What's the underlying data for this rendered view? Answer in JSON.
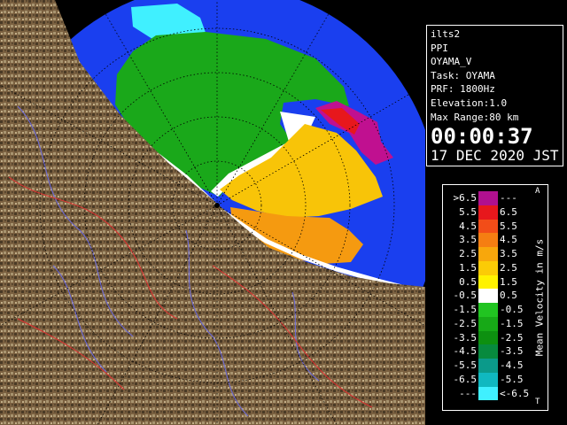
{
  "info": {
    "station_code": "ilts2",
    "product": "PPI",
    "radar_name": "OYAMA_V",
    "task": "Task: OYAMA",
    "prf": "PRF: 1800Hz",
    "elevation": "Elevation:1.0",
    "max_range": "Max Range:80 km",
    "time": "00:00:37",
    "date": "17 DEC 2020 JST"
  },
  "legend": {
    "title": "Mean Velocity in m/s",
    "corner_top": "A",
    "corner_bottom": "T",
    "rows": [
      {
        "lo": ">6.5",
        "hi": "---",
        "color": "#b0108f"
      },
      {
        "lo": "5.5",
        "hi": "6.5",
        "color": "#e7171c"
      },
      {
        "lo": "4.5",
        "hi": "5.5",
        "color": "#f24d18"
      },
      {
        "lo": "3.5",
        "hi": "4.5",
        "color": "#f57e12"
      },
      {
        "lo": "2.5",
        "hi": "3.5",
        "color": "#f8a70c"
      },
      {
        "lo": "1.5",
        "hi": "2.5",
        "color": "#fbcb06"
      },
      {
        "lo": "0.5",
        "hi": "1.5",
        "color": "#fff200"
      },
      {
        "lo": "-0.5",
        "hi": "0.5",
        "color": "#ffffff"
      },
      {
        "lo": "-1.5",
        "hi": "-0.5",
        "color": "#21c421"
      },
      {
        "lo": "-2.5",
        "hi": "-1.5",
        "color": "#17a917"
      },
      {
        "lo": "-3.5",
        "hi": "-2.5",
        "color": "#0d9010"
      },
      {
        "lo": "-4.5",
        "hi": "-3.5",
        "color": "#078a3e"
      },
      {
        "lo": "-5.5",
        "hi": "-4.5",
        "color": "#0b9a8a"
      },
      {
        "lo": "-6.5",
        "hi": "-5.5",
        "color": "#10b8c0"
      },
      {
        "lo": "---",
        "hi": "<-6.5",
        "color": "#40f0ff"
      }
    ]
  },
  "map": {
    "sea_color": "#1a3fef",
    "terrain_color": "#7a6040"
  }
}
